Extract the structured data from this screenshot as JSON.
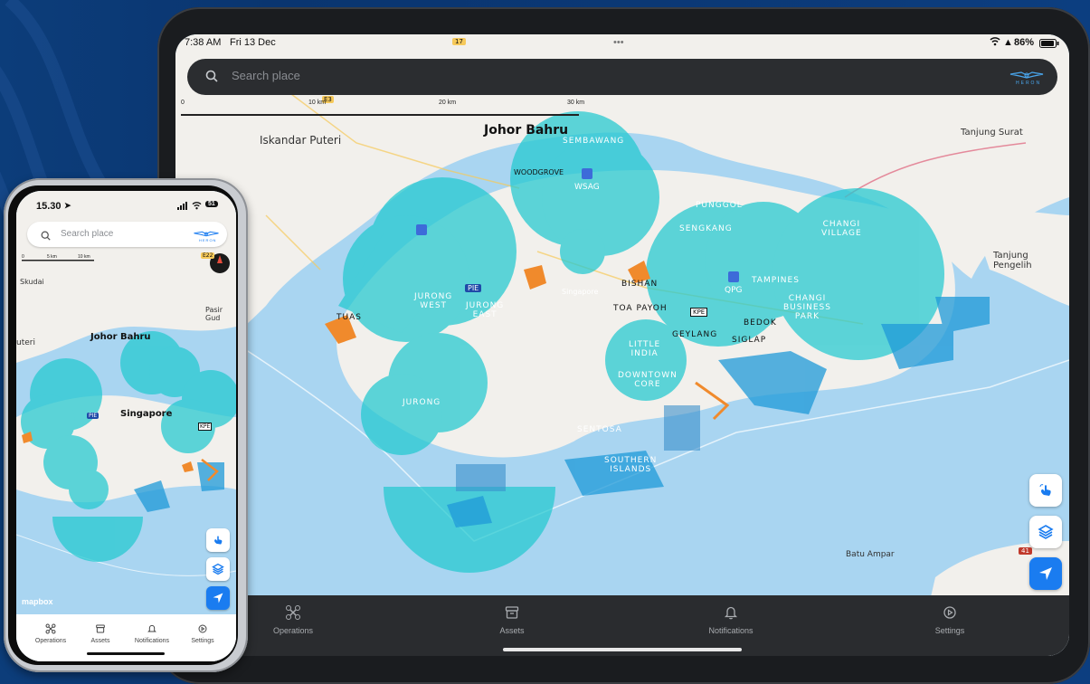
{
  "tablet": {
    "status": {
      "time": "7:38 AM",
      "date": "Fri 13 Dec",
      "battery": "86%"
    },
    "search": {
      "placeholder": "Search place"
    },
    "brand": "HERON",
    "scale": {
      "labels": [
        "0",
        "10 km",
        "20 km",
        "30 km"
      ]
    },
    "map_labels": {
      "johor_bahru": "Johor Bahru",
      "iskandar_puteri": "Iskandar Puteri",
      "sembawang": "SEMBAWANG",
      "woodgrove": "WOODGROVE",
      "wsag": "WSAG",
      "punggol": "PUNGGOL",
      "sengkang": "SENGKANG",
      "changi_village": "CHANGI\nVILLAGE",
      "tanjung_surat": "Tanjung Surat",
      "tanjung_pengelih": "Tanjung\nPengelih",
      "qpg": "QPG",
      "tampines": "TAMPINES",
      "changi_business_park": "CHANGI\nBUSINESS\nPARK",
      "jurong_west": "JURONG\nWEST",
      "jurong_east": "JURONG\nEAST",
      "pie": "PIE",
      "singapore": "Singapore",
      "bishan": "BISHAN",
      "toa_payoh": "TOA PAYOH",
      "kpe": "KPE",
      "bedok": "BEDOK",
      "siglap": "SIGLAP",
      "geylang": "GEYLANG",
      "little_india": "LITTLE\nINDIA",
      "downtown_core": "DOWNTOWN\nCORE",
      "tuas": "TUAS",
      "jurong": "JURONG",
      "sentosa": "SENTOSA",
      "southern_islands": "SOUTHERN\nISLANDS",
      "batu_ampar": "Batu Ampar",
      "e3": "E3",
      "r17": "17",
      "r41": "41"
    },
    "nav": [
      {
        "label": "Operations",
        "icon": "drone-icon"
      },
      {
        "label": "Assets",
        "icon": "archive-box-icon"
      },
      {
        "label": "Notifications",
        "icon": "bell-icon"
      },
      {
        "label": "Settings",
        "icon": "settings-icon"
      }
    ]
  },
  "phone": {
    "status": {
      "time": "15.30",
      "battery": "51"
    },
    "search": {
      "placeholder": "Search place"
    },
    "brand": "HERON",
    "scale": {
      "labels": [
        "0",
        "5 km",
        "10 km"
      ]
    },
    "map_labels": {
      "skudai": "Skudai",
      "pasir_gudang": "Pasir Gud",
      "johor_bahru": "Johor Bahru",
      "puteri": "uteri",
      "singapore": "Singapore",
      "pie": "PIE",
      "kpe": "KPE",
      "e22": "E22"
    },
    "attribution": "mapbox",
    "nav": [
      {
        "label": "Operations",
        "icon": "drone-icon"
      },
      {
        "label": "Assets",
        "icon": "archive-box-icon"
      },
      {
        "label": "Notifications",
        "icon": "bell-icon"
      },
      {
        "label": "Settings",
        "icon": "settings-icon"
      }
    ]
  },
  "colors": {
    "zone_fill": "#22c9d0",
    "water": "#a9d5f1",
    "land": "#f2f0ec",
    "accent": "#1a7cf0",
    "nav_bg": "#2a2c2f",
    "restricted": "#f08a2c"
  }
}
